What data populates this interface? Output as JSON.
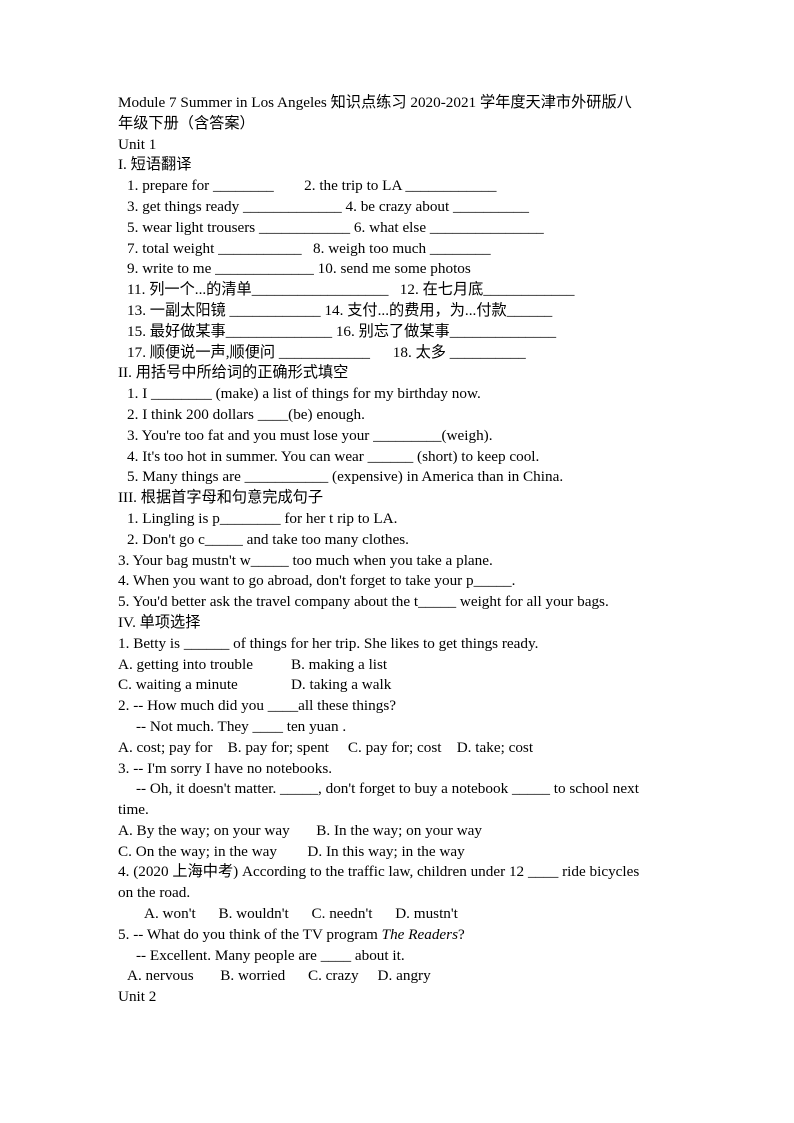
{
  "document": {
    "title_line_1": "Module 7 Summer in Los Angeles 知识点练习 2020-2021 学年度天津市外研版八",
    "title_line_2": "年级下册（含答案）",
    "unit_1_heading": "Unit 1",
    "unit_2_heading": "Unit 2",
    "sections": [
      {
        "heading": "I. 短语翻译",
        "lines": [
          {
            "text": "1. prepare for ________        2. the trip to LA ____________",
            "indent": 1
          },
          {
            "text": "3. get things ready _____________ 4. be crazy about __________",
            "indent": 1
          },
          {
            "text": "5. wear light trousers ____________ 6. what else _______________",
            "indent": 1
          },
          {
            "text": "7. total weight ___________   8. weigh too much ________",
            "indent": 1
          },
          {
            "text": "9. write to me _____________ 10. send me some photos",
            "indent": 1
          },
          {
            "text": "11. 列一个...的清单__________________   12. 在七月底____________",
            "indent": 1
          },
          {
            "text": "13. 一副太阳镜 ____________ 14. 支付...的费用，为...付款______",
            "indent": 1
          },
          {
            "text": "15. 最好做某事______________ 16. 别忘了做某事______________",
            "indent": 1
          },
          {
            "text": "17. 顺便说一声,顺便问 ____________      18. 太多 __________",
            "indent": 1
          }
        ]
      },
      {
        "heading": "II. 用括号中所给词的正确形式填空",
        "lines": [
          {
            "text": "1. I ________ (make) a list of things for my birthday now.",
            "indent": 1
          },
          {
            "text": "2. I think 200 dollars ____(be) enough.",
            "indent": 1
          },
          {
            "text": "3. You're too fat and you must lose your _________(weigh).",
            "indent": 1
          },
          {
            "text": "4. It's too hot in summer. You can wear ______ (short) to keep cool.",
            "indent": 1
          },
          {
            "text": "5. Many things are ___________ (expensive) in America than in China.",
            "indent": 1
          }
        ]
      },
      {
        "heading": "III. 根据首字母和句意完成句子",
        "lines": [
          {
            "text": "1. Lingling is p________ for her t rip to LA.",
            "indent": 1
          },
          {
            "text": "2. Don't go c_____ and take too many clothes.",
            "indent": 1
          },
          {
            "text": "3. Your bag mustn't w_____ too much when you take a plane.",
            "indent": 0
          },
          {
            "text": "4. When you want to go abroad, don't forget to take your p_____.",
            "indent": 0
          },
          {
            "text": "5. You'd better ask the travel company about the t_____ weight for all your bags.",
            "indent": 0
          }
        ]
      },
      {
        "heading": "IV. 单项选择",
        "lines": [
          {
            "text": "1. Betty is ______ of things for her trip. She likes to get things ready.",
            "indent": 0
          },
          {
            "text": "A. getting into trouble          B. making a list",
            "indent": 0
          },
          {
            "text": "C. waiting a minute              D. taking a walk",
            "indent": 0
          },
          {
            "text": "2. -- How much did you ____all these things?",
            "indent": 0
          },
          {
            "text": "-- Not much. They ____ ten yuan .",
            "indent": 2
          },
          {
            "text": "A. cost; pay for    B. pay for; spent     C. pay for; cost    D. take; cost",
            "indent": 0
          },
          {
            "text": "3. -- I'm sorry I have no notebooks.",
            "indent": 0
          },
          {
            "text": "-- Oh, it doesn't matter. _____, don't forget to buy a notebook _____ to school next",
            "indent": 2
          },
          {
            "text": "time.",
            "indent": 0
          },
          {
            "text": "A. By the way; on your way       B. In the way; on your way",
            "indent": 0
          },
          {
            "text": "C. On the way; in the way        D. In this way; in the way",
            "indent": 0
          },
          {
            "text": "4. (2020 上海中考) According to the traffic law, children under 12 ____ ride bicycles",
            "indent": 0
          },
          {
            "text": "on the road.",
            "indent": 0
          },
          {
            "text": "A. won't      B. wouldn't      C. needn't      D. mustn't",
            "indent": 3
          },
          {
            "text": "5. -- What do you think of the TV program ",
            "italic": "The Readers",
            "text_after": "?",
            "indent": 0
          },
          {
            "text": "-- Excellent. Many people are ____ about it.",
            "indent": 2
          },
          {
            "text": "A. nervous       B. worried      C. crazy     D. angry",
            "indent": 1
          }
        ]
      }
    ]
  }
}
